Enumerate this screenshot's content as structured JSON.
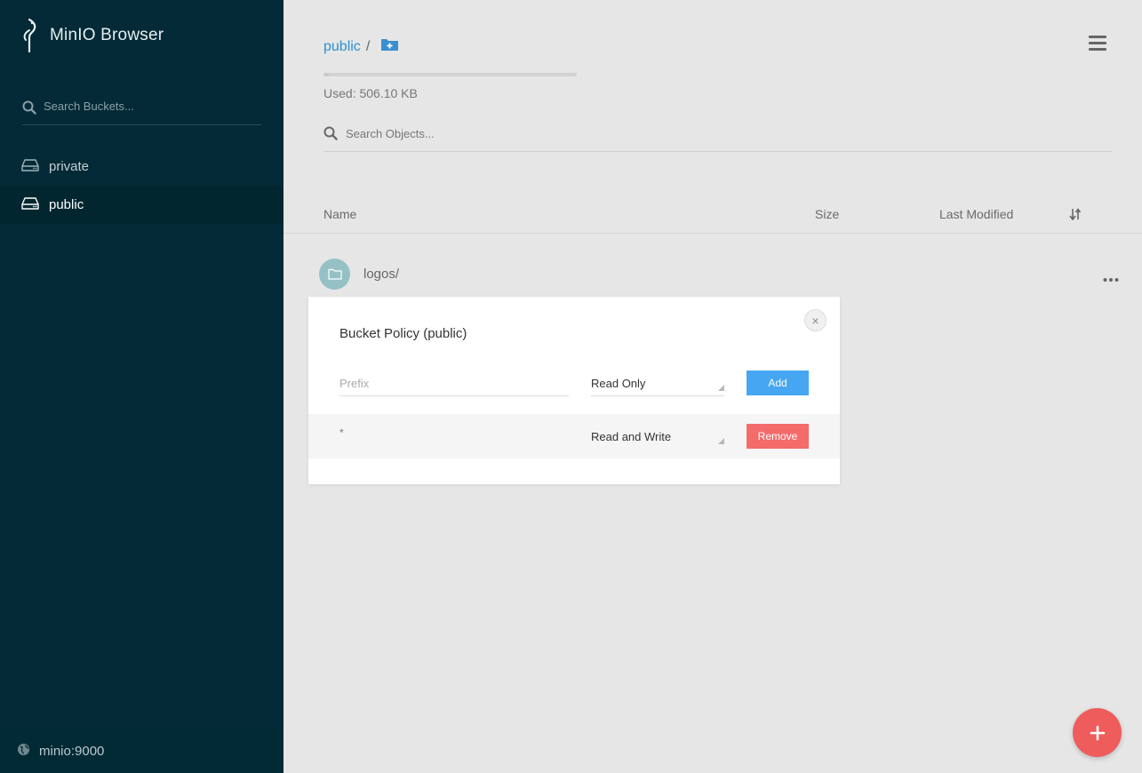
{
  "app": {
    "title": "MinIO Browser"
  },
  "sidebar": {
    "search_placeholder": "Search Buckets...",
    "buckets": [
      {
        "label": "private",
        "active": false
      },
      {
        "label": "public",
        "active": true
      }
    ],
    "host": "minio:9000"
  },
  "main": {
    "breadcrumb": {
      "bucket": "public",
      "separator": "/"
    },
    "usage": {
      "text": "Used: 506.10 KB"
    },
    "search_placeholder": "Search Objects...",
    "columns": {
      "name": "Name",
      "size": "Size",
      "last_modified": "Last Modified"
    },
    "objects": [
      {
        "name": "logos/",
        "type": "folder"
      }
    ]
  },
  "modal": {
    "title": "Bucket Policy (public)",
    "new_policy": {
      "prefix_placeholder": "Prefix",
      "selected": "Read Only",
      "button": "Add"
    },
    "policies": [
      {
        "prefix": "*",
        "policy": "Read and Write",
        "button": "Remove"
      }
    ],
    "close_label": "×"
  },
  "colors": {
    "sidebar_bg": "#032a36",
    "link": "#2d8fd0",
    "add_button": "#46a6f1",
    "remove_button": "#f46b6b",
    "fab": "#ef5c5c"
  },
  "icons": {
    "logo": "minio-bird-icon",
    "search": "search-icon",
    "bucket": "hard-drive-icon",
    "host": "globe-icon",
    "new_folder": "folder-plus-icon",
    "menu": "hamburger-menu-icon",
    "sort": "sort-icon",
    "folder": "folder-icon",
    "row_actions": "more-horizontal-icon",
    "fab": "plus-icon"
  }
}
